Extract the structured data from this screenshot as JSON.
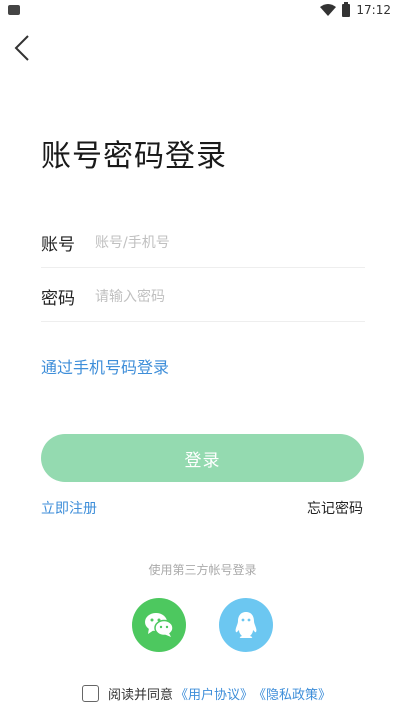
{
  "status_bar": {
    "time": "17:12",
    "icons": [
      "app-icon",
      "wifi-icon",
      "battery-icon"
    ]
  },
  "header": {
    "back_icon": "chevron-left-icon"
  },
  "title": "账号密码登录",
  "form": {
    "account": {
      "label": "账号",
      "placeholder": "账号/手机号",
      "value": ""
    },
    "password": {
      "label": "密码",
      "placeholder": "请输入密码",
      "value": ""
    }
  },
  "phone_login_link": "通过手机号码登录",
  "login_button": "登录",
  "register_link": "立即注册",
  "forgot_link": "忘记密码",
  "third_party": {
    "label": "使用第三方帐号登录",
    "providers": [
      {
        "name": "wechat",
        "icon": "wechat-icon",
        "color": "#4dc85f"
      },
      {
        "name": "qq",
        "icon": "qq-icon",
        "color": "#6cc7f1"
      }
    ]
  },
  "agreement": {
    "checked": false,
    "text": "阅读并同意",
    "user_agreement": "《用户协议》",
    "privacy_policy": "《隐私政策》"
  },
  "colors": {
    "accent": "#3e8ed9",
    "login_button": "#94dab0",
    "wechat": "#4dc85f",
    "qq": "#6cc7f1"
  }
}
